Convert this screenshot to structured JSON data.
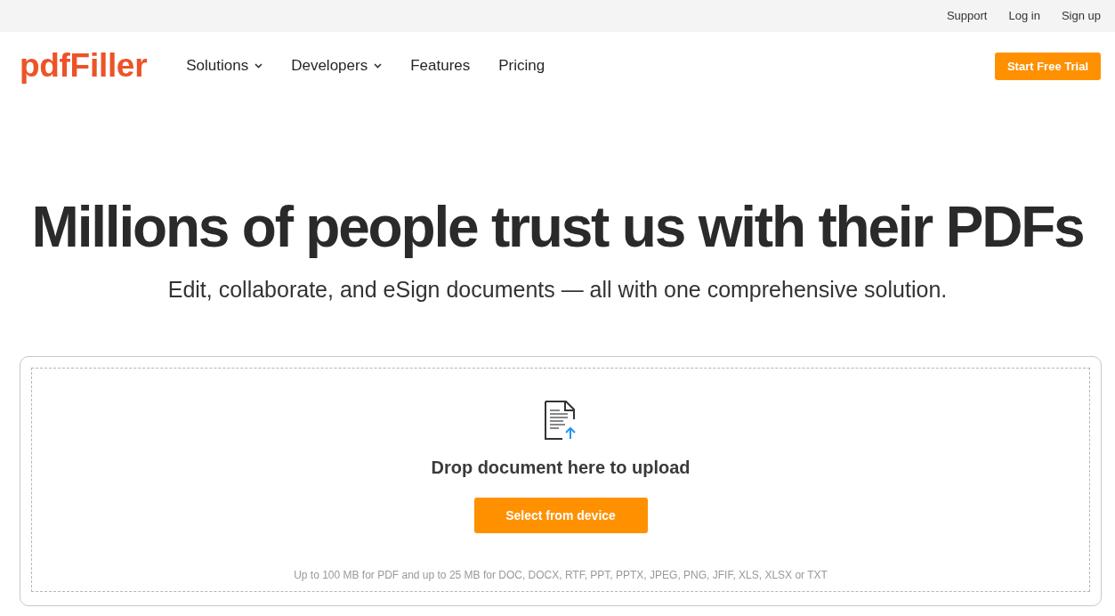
{
  "top_bar": {
    "links": [
      "Support",
      "Log in",
      "Sign up"
    ]
  },
  "header": {
    "logo": "pdfFiller",
    "nav": [
      {
        "label": "Solutions",
        "has_dropdown": true
      },
      {
        "label": "Developers",
        "has_dropdown": true
      },
      {
        "label": "Features",
        "has_dropdown": false
      },
      {
        "label": "Pricing",
        "has_dropdown": false
      }
    ],
    "cta": "Start Free Trial"
  },
  "hero": {
    "title": "Millions of people trust us with their PDFs",
    "subtitle": "Edit, collaborate, and eSign documents — all with one comprehensive solution."
  },
  "upload": {
    "prompt": "Drop document here to upload",
    "button": "Select from device",
    "note": "Up to 100 MB for PDF and up to 25 MB for DOC, DOCX, RTF, PPT, PPTX, JPEG, PNG, JFIF, XLS, XLSX or TXT"
  }
}
